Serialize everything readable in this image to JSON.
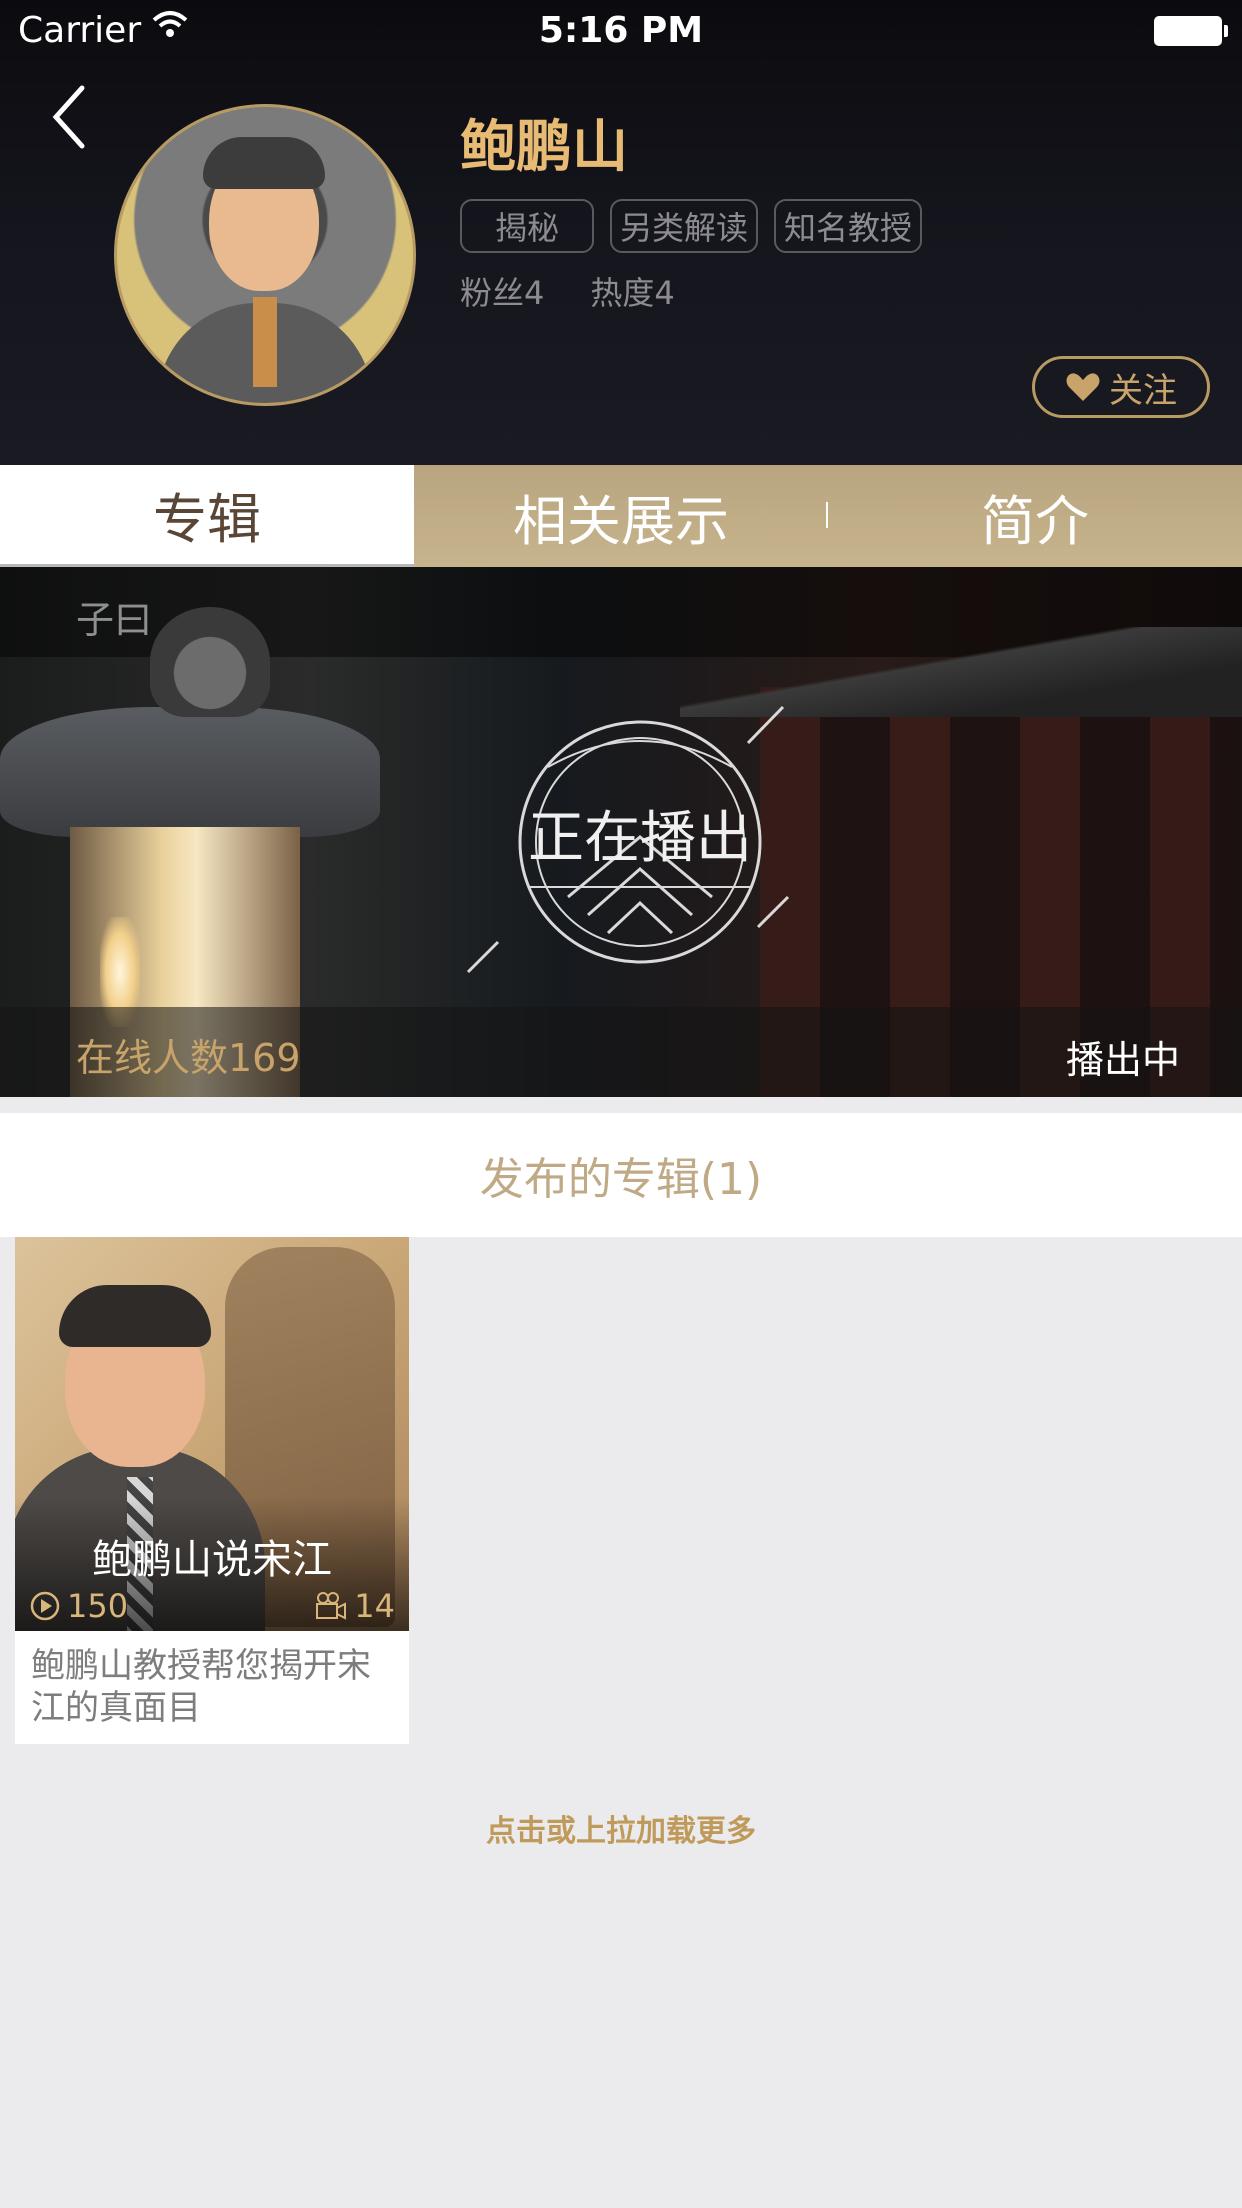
{
  "status_bar": {
    "carrier": "Carrier",
    "time": "5:16 PM"
  },
  "profile": {
    "name": "鲍鹏山",
    "tags": [
      "揭秘",
      "另类解读",
      "知名教授"
    ],
    "fans": "粉丝4",
    "heat": "热度4",
    "follow_label": "关注"
  },
  "tabs": [
    {
      "label": "专辑",
      "active": true
    },
    {
      "label": "相关展示",
      "active": false
    },
    {
      "label": "简介",
      "active": false
    }
  ],
  "banner": {
    "label": "子曰",
    "live_text": "正在播出",
    "online": "在线人数169",
    "status": "播出中"
  },
  "albums_section": {
    "title": "发布的专辑(1)",
    "albums": [
      {
        "title": "鲍鹏山说宋江",
        "plays": "150",
        "episodes": "14",
        "description": "鲍鹏山教授帮您揭开宋江的真面目"
      }
    ],
    "load_more": "点击或上拉加载更多"
  },
  "colors": {
    "accent_gold": "#c9a46a",
    "name_gold": "#e7bb73",
    "tab_bar": "#c0ab84",
    "background": "#ebebed"
  }
}
